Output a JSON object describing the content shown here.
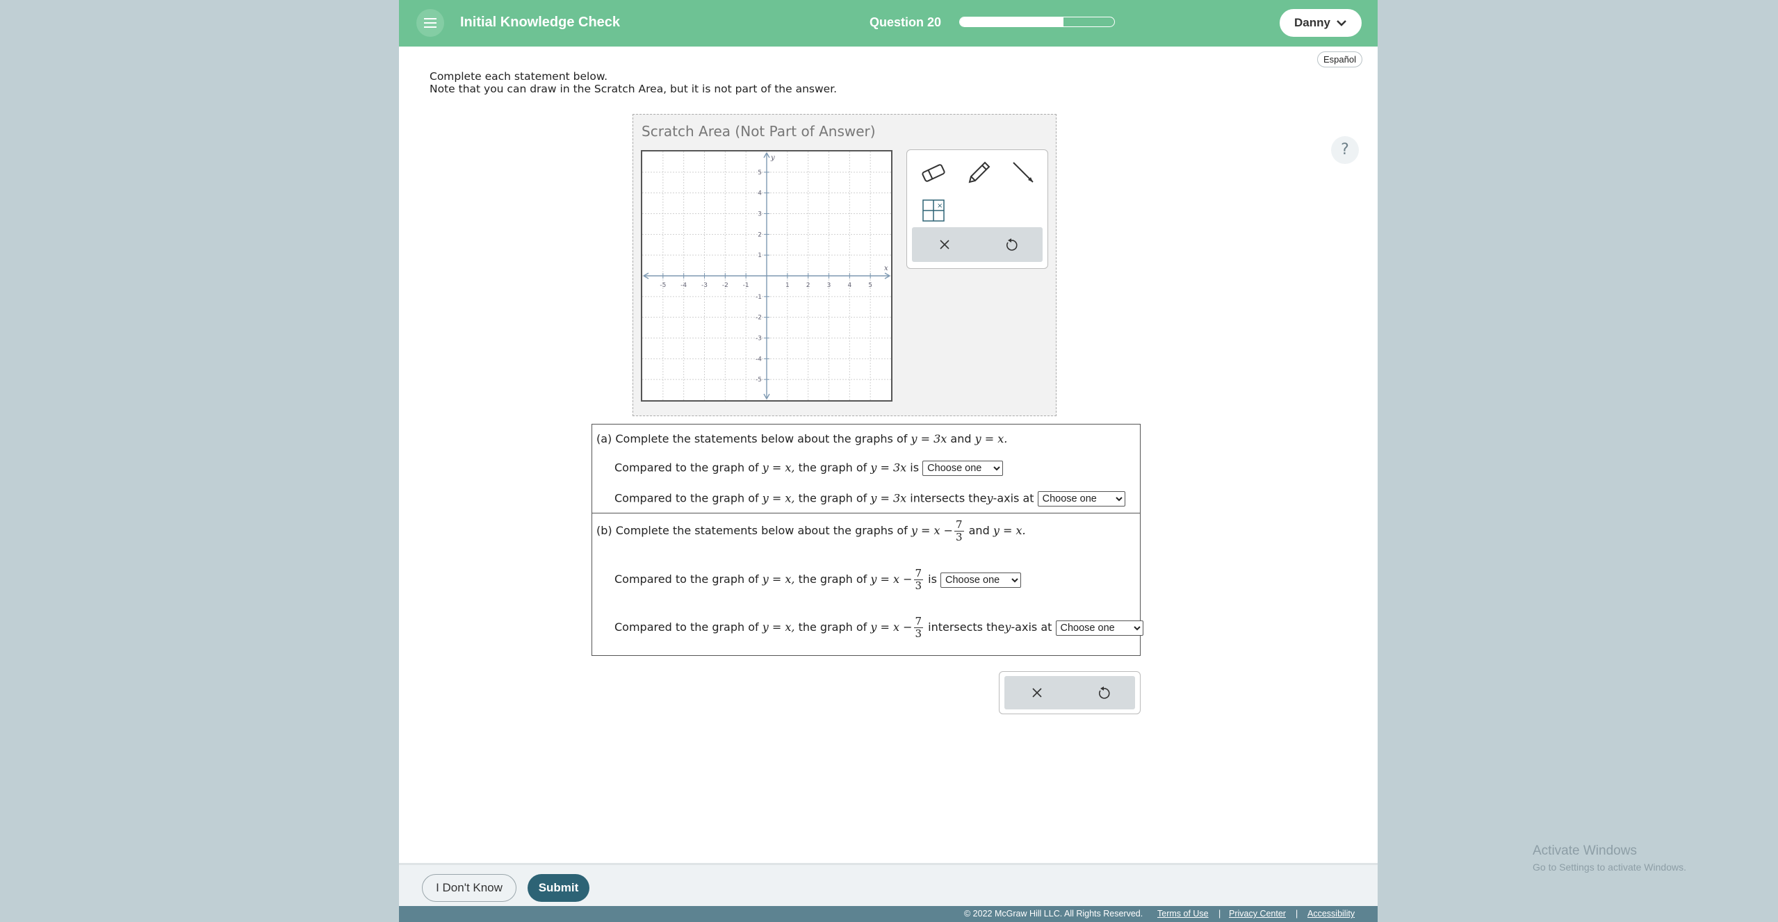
{
  "header": {
    "app_title": "Initial Knowledge Check",
    "question_label": "Question 20",
    "progress_fraction": 0.67,
    "user_name": "Danny",
    "accent_color": "#6ec294"
  },
  "language_button": "Español",
  "help_label": "?",
  "instructions": {
    "line1": "Complete each statement below.",
    "line2": "Note that you can draw in the Scratch Area, but it is not part of the answer."
  },
  "scratch": {
    "title": "Scratch Area (Not Part of Answer)",
    "graph": {
      "x_label": "x",
      "y_label": "y",
      "x_ticks": [
        "-5",
        "-4",
        "-3",
        "-2",
        "-1",
        "1",
        "2",
        "3",
        "4",
        "5"
      ],
      "y_ticks": [
        "5",
        "4",
        "3",
        "2",
        "1",
        "-1",
        "-2",
        "-3",
        "-4",
        "-5"
      ]
    },
    "tools": [
      "eraser-icon",
      "pencil-icon",
      "line-icon",
      "grid-icon"
    ]
  },
  "part_a": {
    "intro_prefix": "(a) Complete the statements below about the graphs of",
    "intro_eq1": "y = 3x",
    "intro_and": "and",
    "intro_eq2": "y = x.",
    "s1_prefix": "Compared to the graph of",
    "s1_eq1": "y = x,",
    "s1_mid": "the graph of",
    "s1_eq2": "y = 3x",
    "s1_suffix": "is",
    "s2_prefix": "Compared to the graph of",
    "s2_eq1": "y = x,",
    "s2_mid": "the graph of",
    "s2_eq2": "y = 3x",
    "s2_suffix_a": "intersects the",
    "s2_yvar": "y",
    "s2_suffix_b": "-axis at"
  },
  "part_b": {
    "intro_prefix": "(b) Complete the statements below about the graphs of",
    "intro_eq1": "y = x −",
    "frac_num": "7",
    "frac_den": "3",
    "intro_and": "and",
    "intro_eq2": "y = x.",
    "s1_prefix": "Compared to the graph of",
    "s1_eq1": "y = x,",
    "s1_mid": "the graph of",
    "s1_eq2": "y = x −",
    "s1_suffix": "is",
    "s2_prefix": "Compared to the graph of",
    "s2_eq1": "y = x,",
    "s2_mid": "the graph of",
    "s2_eq2": "y = x −",
    "s2_suffix_a": "intersects the",
    "s2_yvar": "y",
    "s2_suffix_b": "-axis at"
  },
  "dropdown_placeholder": "Choose one",
  "footer": {
    "dont_know": "I Don't Know",
    "submit": "Submit",
    "copyright": "© 2022 McGraw Hill LLC. All Rights Reserved.",
    "terms": "Terms of Use",
    "privacy": "Privacy Center",
    "accessibility": "Accessibility",
    "separator": "|"
  },
  "watermark": {
    "line1": "Activate Windows",
    "line2": "Go to Settings to activate Windows."
  }
}
